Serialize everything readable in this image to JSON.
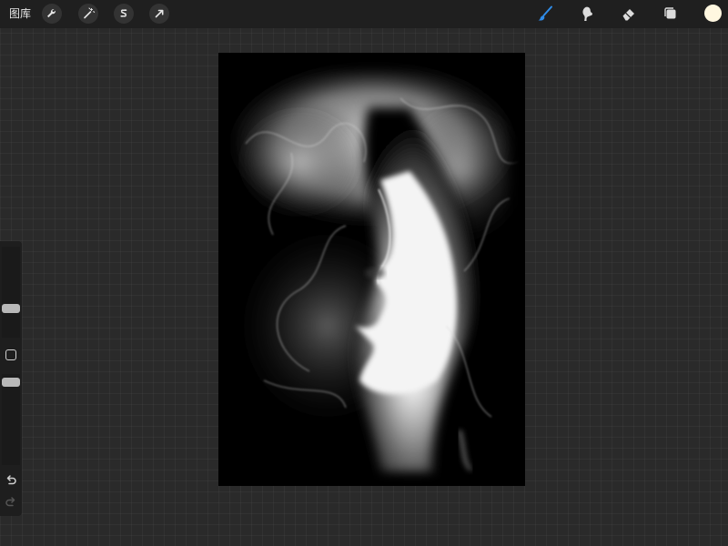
{
  "topbar": {
    "gallery_label": "图库",
    "left_tools": [
      {
        "name": "actions",
        "icon": "wrench-icon"
      },
      {
        "name": "adjustments",
        "icon": "magic-wand-icon"
      },
      {
        "name": "selection",
        "icon": "selection-s-icon"
      },
      {
        "name": "transform",
        "icon": "arrow-cursor-icon"
      }
    ],
    "right_tools": [
      {
        "name": "brush",
        "icon": "brush-icon",
        "active": true
      },
      {
        "name": "smudge",
        "icon": "smudge-icon",
        "active": false
      },
      {
        "name": "eraser",
        "icon": "eraser-icon",
        "active": false
      },
      {
        "name": "layers",
        "icon": "layers-icon",
        "active": false
      }
    ],
    "current_color": "#fff7e0"
  },
  "sidebar": {
    "brush_size_slider": {
      "icon": "slider-handle"
    },
    "opacity_slider": {
      "icon": "slider-handle"
    },
    "modify_button": {
      "icon": "square-outline-icon"
    },
    "undo": {
      "icon": "undo-icon"
    },
    "redo": {
      "icon": "redo-icon"
    }
  },
  "colors": {
    "accent": "#2f8ce8",
    "toolbar_bg": "#1f1f1f",
    "workspace_bg": "#2a2a2a"
  }
}
